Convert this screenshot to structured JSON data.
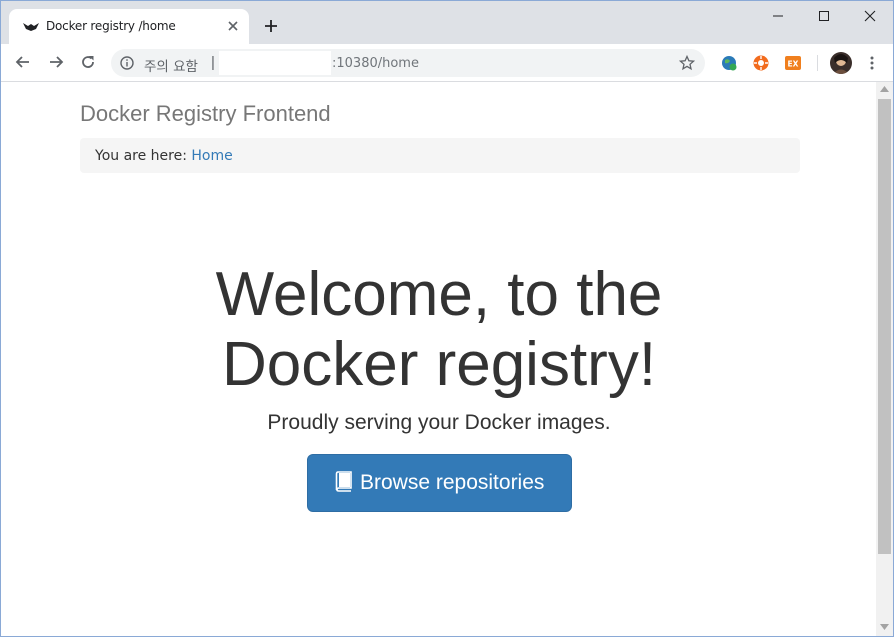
{
  "browser": {
    "tab_title": "Docker registry /home",
    "security_label": "주의 요함",
    "security_separator": "|",
    "url_visible": ":10380/home",
    "icons": {
      "favicon": "docker-registry-logo-icon",
      "tab_close": "close-icon",
      "new_tab": "plus-icon",
      "back": "arrow-left-icon",
      "forward": "arrow-right-icon",
      "reload": "reload-icon",
      "info": "info-icon",
      "bookmark": "star-icon",
      "extensions": [
        "globe-extension-icon",
        "orange-circle-extension-icon",
        "ex-extension-icon"
      ],
      "profile": "avatar",
      "menu": "three-dots-icon",
      "window": [
        "minimize-icon",
        "maximize-icon",
        "close-window-icon"
      ]
    },
    "extension_badge_text": "EX"
  },
  "page": {
    "brand": "Docker Registry Frontend",
    "breadcrumb": {
      "prefix": "You are here:",
      "link": "Home"
    },
    "jumbotron": {
      "title_line1": "Welcome, to the",
      "title_line2": "Docker registry!",
      "subtitle": "Proudly serving your Docker images.",
      "button_label": "Browse repositories"
    }
  },
  "colors": {
    "primary_button": "#337ab7",
    "link": "#337ab7",
    "brand_text": "#777777",
    "breadcrumb_bg": "#f5f5f5",
    "tab_strip": "#dee1e6"
  }
}
